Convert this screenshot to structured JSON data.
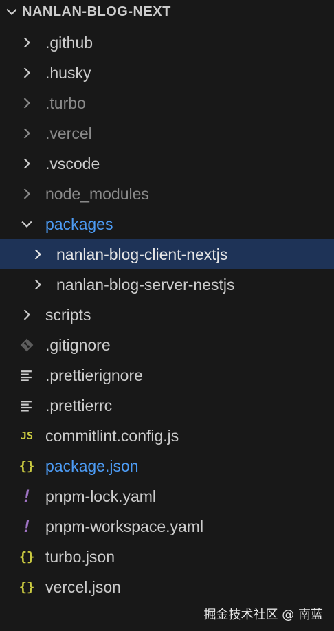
{
  "explorer": {
    "title": "NANLAN-BLOG-NEXT",
    "items": [
      {
        "label": ".github",
        "icon": "chevron-right-icon"
      },
      {
        "label": ".husky",
        "icon": "chevron-right-icon"
      },
      {
        "label": ".turbo",
        "icon": "chevron-right-icon"
      },
      {
        "label": ".vercel",
        "icon": "chevron-right-icon"
      },
      {
        "label": ".vscode",
        "icon": "chevron-right-icon"
      },
      {
        "label": "node_modules",
        "icon": "chevron-right-icon"
      },
      {
        "label": "packages",
        "icon": "chevron-down-icon"
      },
      {
        "label": "nanlan-blog-client-nextjs",
        "icon": "chevron-right-icon"
      },
      {
        "label": "nanlan-blog-server-nestjs",
        "icon": "chevron-right-icon"
      },
      {
        "label": "scripts",
        "icon": "chevron-right-icon"
      },
      {
        "label": ".gitignore",
        "icon": "git-icon"
      },
      {
        "label": ".prettierignore",
        "icon": "lines-icon"
      },
      {
        "label": ".prettierrc",
        "icon": "lines-icon"
      },
      {
        "label": "commitlint.config.js",
        "icon": "js-icon",
        "glyph": "JS"
      },
      {
        "label": "package.json",
        "icon": "json-icon",
        "glyph": "{}"
      },
      {
        "label": "pnpm-lock.yaml",
        "icon": "yaml-icon",
        "glyph": "!"
      },
      {
        "label": "pnpm-workspace.yaml",
        "icon": "yaml-icon",
        "glyph": "!"
      },
      {
        "label": "turbo.json",
        "icon": "json-icon",
        "glyph": "{}"
      },
      {
        "label": "vercel.json",
        "icon": "json-icon",
        "glyph": "{}"
      }
    ]
  },
  "colors": {
    "background": "#181818",
    "text": "#cccccc",
    "dimmed_text": "#8b8b8b",
    "modified_blue": "#4d9cf5",
    "selection": "#1e3357",
    "json_yellow": "#cbcb41",
    "yaml_purple": "#a074c4"
  },
  "watermark": "掘金技术社区 @ 南蓝"
}
